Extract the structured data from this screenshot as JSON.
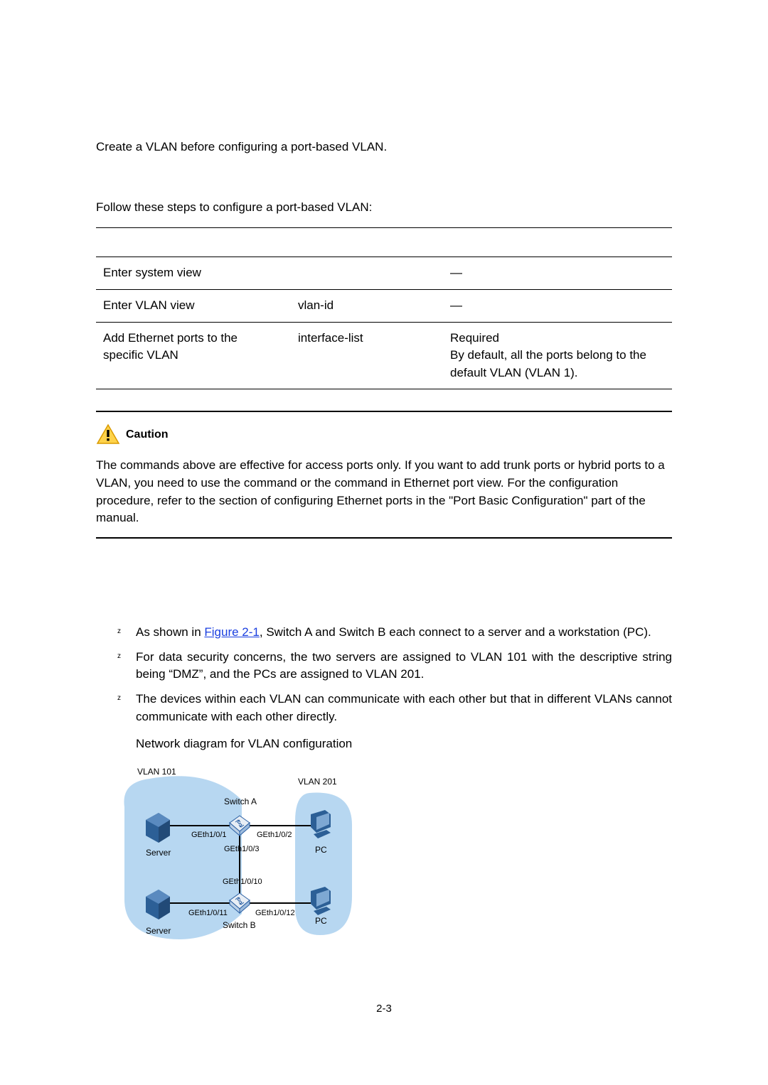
{
  "intro": {
    "note": "Create a VLAN before configuring a port-based VLAN.",
    "lead": "Follow these steps to configure a port-based VLAN:"
  },
  "table": {
    "rows": [
      {
        "a": "Enter system view",
        "b": "",
        "c": "—"
      },
      {
        "a": "Enter VLAN view",
        "b": "vlan-id",
        "c": "—"
      },
      {
        "a": "Add Ethernet ports to the specific VLAN",
        "b": "interface-list",
        "c": "Required\nBy default, all the ports belong to the default VLAN (VLAN 1)."
      }
    ]
  },
  "caution": {
    "title": "Caution",
    "body": "The commands above are effective for access ports only. If you want to add trunk ports or hybrid ports to a VLAN, you need to use the                                       command or the                               command in Ethernet port view. For the configuration procedure, refer to the section of configuring Ethernet ports in the \"Port Basic Configuration\" part of the manual."
  },
  "requirements": {
    "items": [
      {
        "pre": "As shown in ",
        "link": "Figure 2-1",
        "post": ", Switch A and Switch B each connect to a server and a workstation (PC)."
      },
      {
        "text": "For data security concerns, the two servers are assigned to VLAN 101 with the descriptive string being “DMZ”, and the PCs are assigned to VLAN 201."
      },
      {
        "text": "The devices within each VLAN can communicate with each other but that in different VLANs cannot communicate with each other directly."
      }
    ]
  },
  "figure": {
    "caption": "Network diagram for VLAN configuration",
    "vlan101": "VLAN 101",
    "vlan201": "VLAN 201",
    "switchA": "Switch A",
    "switchB": "Switch B",
    "server": "Server",
    "pc": "PC",
    "ge101": "GEth1/0/1",
    "ge102": "GEth1/0/2",
    "ge103": "GEth1/0/3",
    "ge1010": "GEth1/0/10",
    "ge1011": "GEth1/0/11",
    "ge1012": "GEth1/0/12"
  },
  "pagenum": "2-3"
}
